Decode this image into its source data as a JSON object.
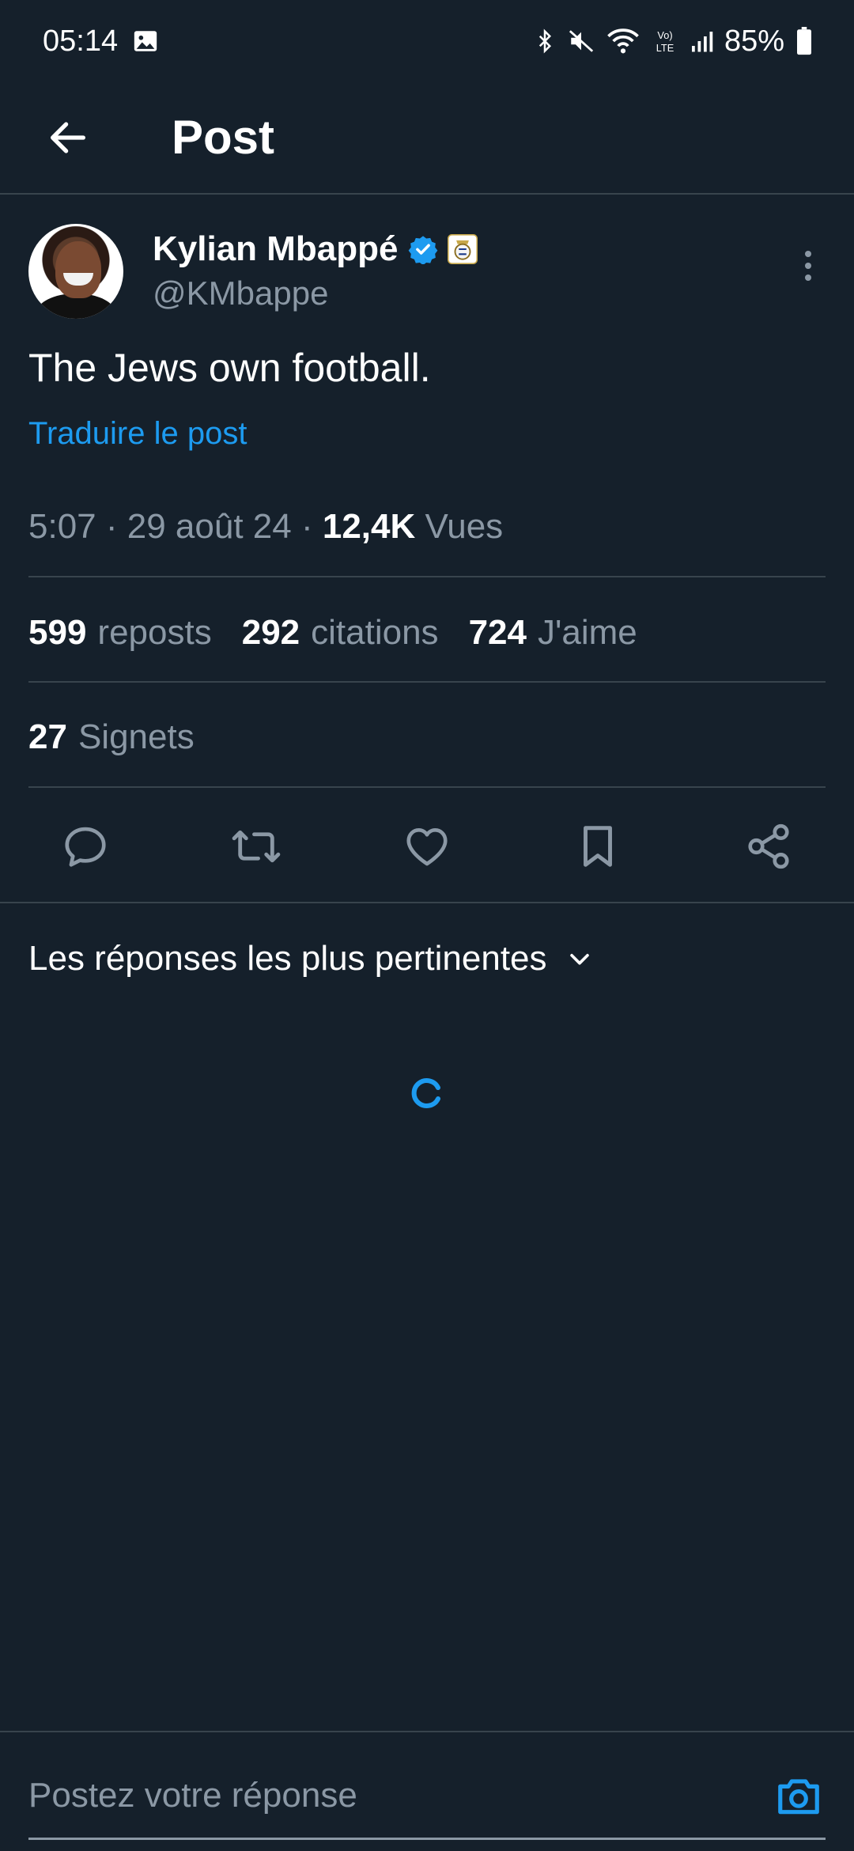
{
  "status_bar": {
    "time": "05:14",
    "battery": "85%",
    "icons": [
      "image-icon",
      "bluetooth-icon",
      "mute-icon",
      "wifi-icon",
      "volte-icon",
      "signal-icon",
      "battery-icon"
    ]
  },
  "header": {
    "title": "Post",
    "back_icon": "arrow-left-icon"
  },
  "post": {
    "author_name": "Kylian Mbappé",
    "author_handle": "@KMbappe",
    "text": "The Jews own football.",
    "translate_label": "Traduire le post",
    "time": "5:07",
    "date": "29 août 24",
    "views_count": "12,4K",
    "views_label": "Vues"
  },
  "stats": {
    "reposts_count": "599",
    "reposts_label": "reposts",
    "quotes_count": "292",
    "quotes_label": "citations",
    "likes_count": "724",
    "likes_label": "J'aime",
    "bookmarks_count": "27",
    "bookmarks_label": "Signets"
  },
  "actions": [
    "reply-icon",
    "repost-icon",
    "like-icon",
    "bookmark-icon",
    "share-icon"
  ],
  "replies": {
    "sort_label": "Les réponses les plus pertinentes"
  },
  "reply_bar": {
    "placeholder": "Postez votre réponse"
  },
  "colors": {
    "background": "#15202b",
    "accent": "#1d9bf0",
    "secondary_text": "#8b98a5",
    "divider": "#38444d"
  }
}
